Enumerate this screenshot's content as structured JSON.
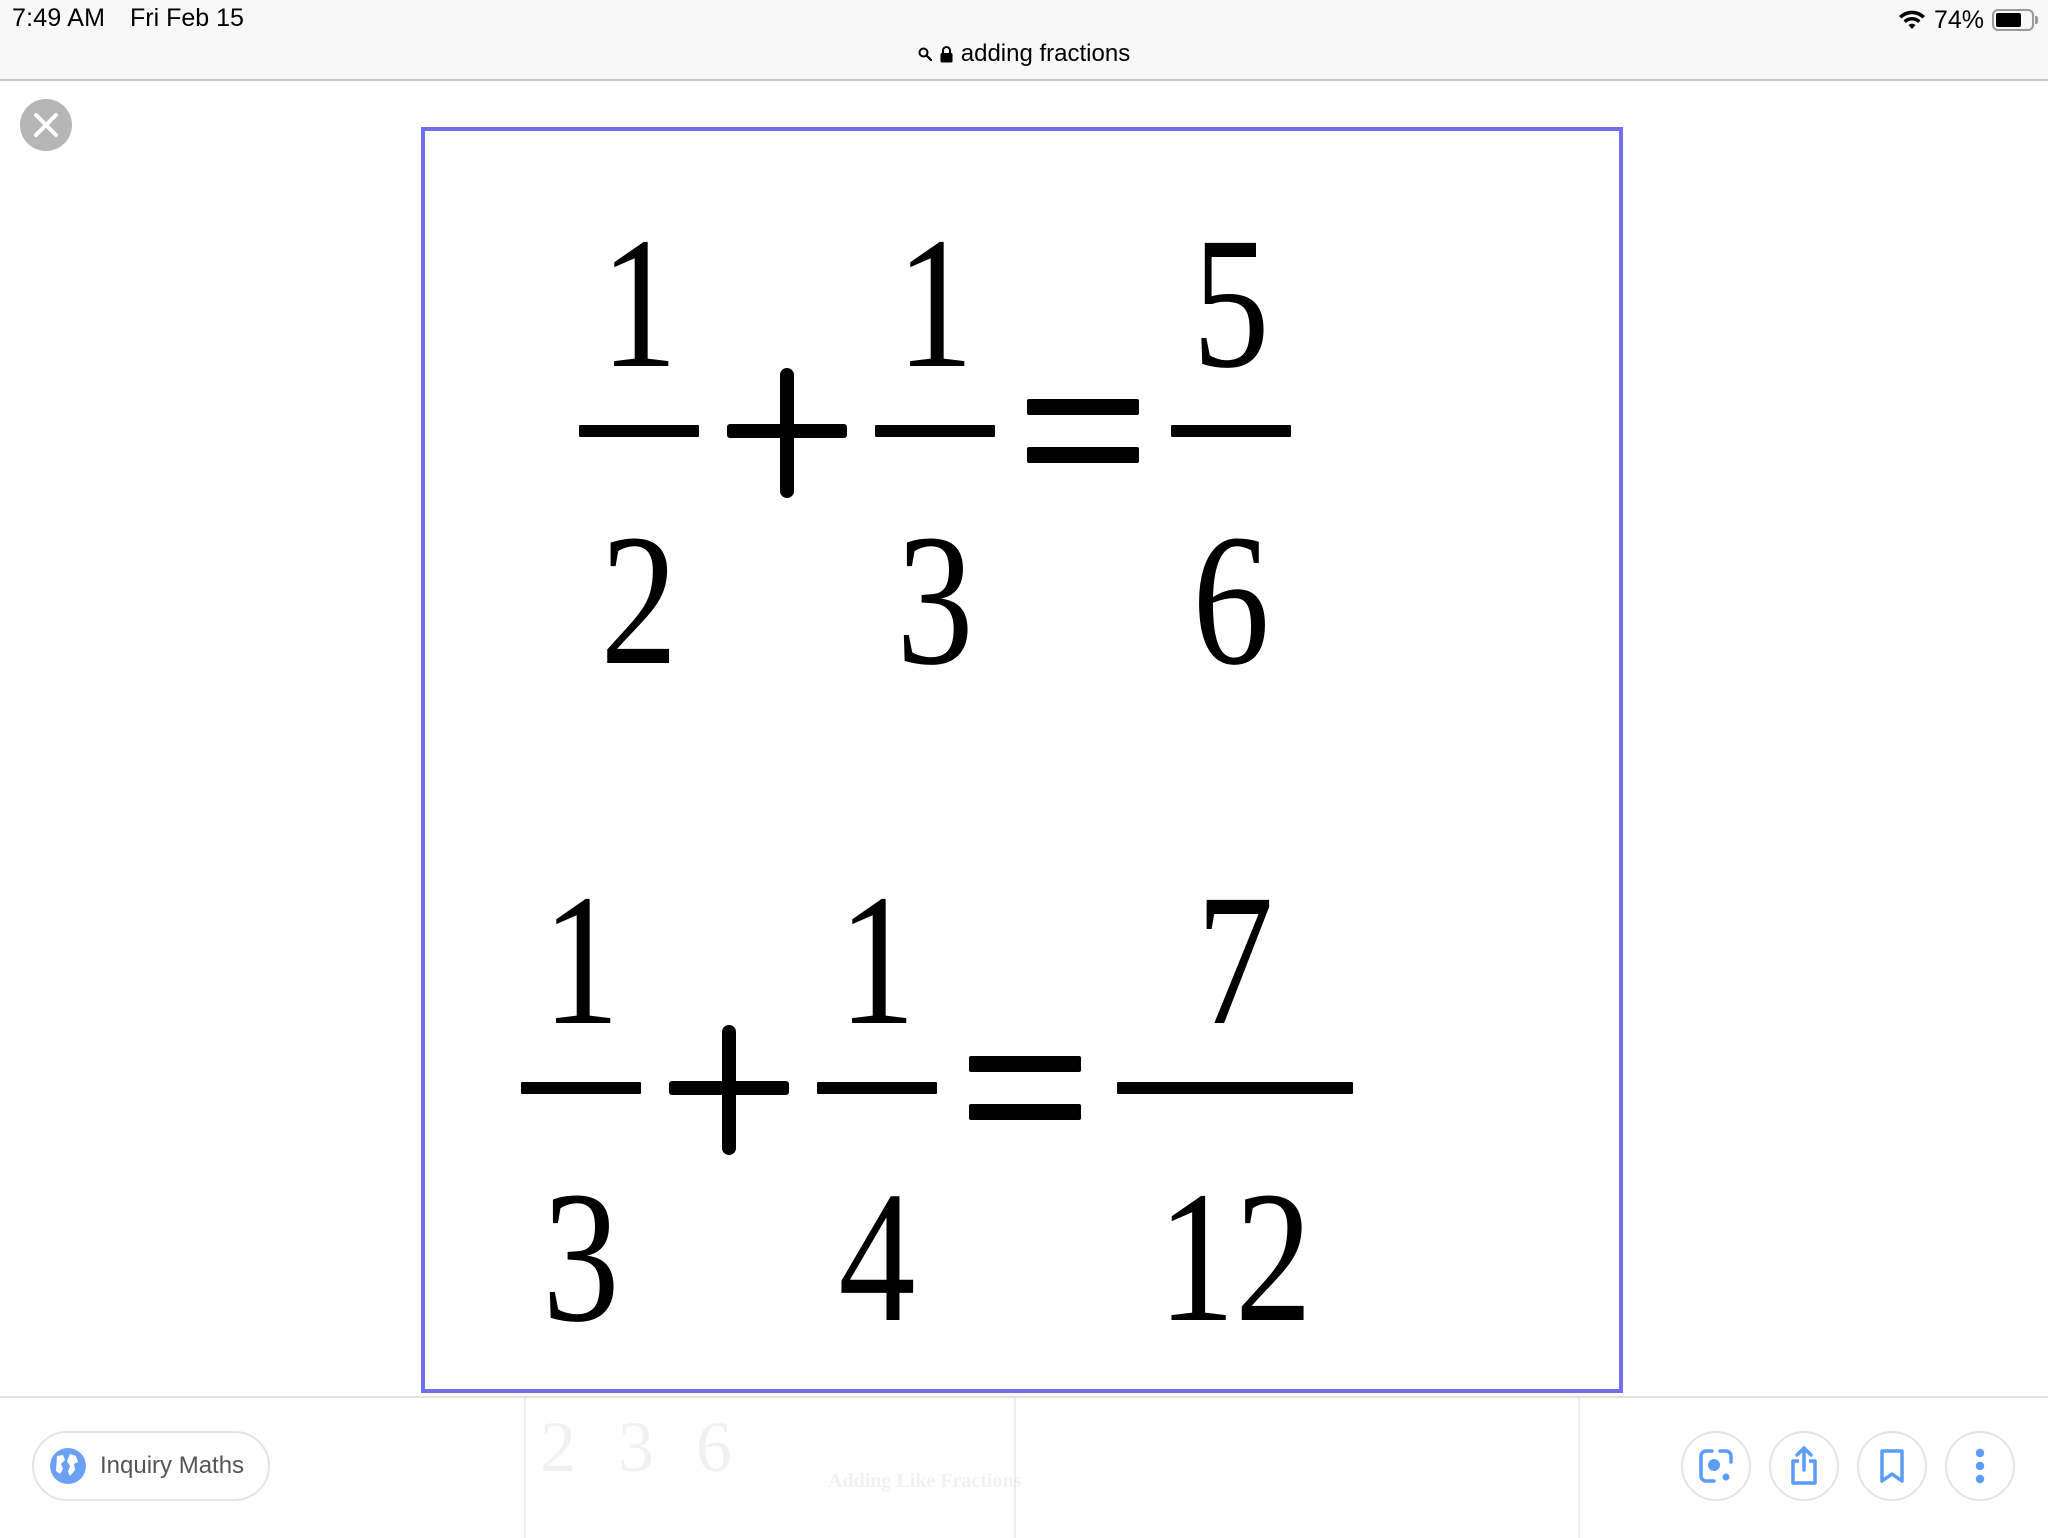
{
  "status_bar": {
    "time": "7:49 AM",
    "date": "Fri Feb 15",
    "battery_percent_label": "74%",
    "battery_level": 0.74,
    "wifi": "wifi-icon"
  },
  "url_bar": {
    "search_icon": "search-icon",
    "lock_icon": "lock-icon",
    "title": "adding fractions"
  },
  "viewer": {
    "close_label": "Close",
    "frame_color": "#7070ef",
    "equations": [
      {
        "left": {
          "numerator": "1",
          "denominator": "2"
        },
        "operator": "+",
        "right": {
          "numerator": "1",
          "denominator": "3"
        },
        "equals": "=",
        "result": {
          "numerator": "5",
          "denominator": "6"
        }
      },
      {
        "left": {
          "numerator": "1",
          "denominator": "3"
        },
        "operator": "+",
        "right": {
          "numerator": "1",
          "denominator": "4"
        },
        "equals": "=",
        "result": {
          "numerator": "7",
          "denominator": "12"
        }
      }
    ]
  },
  "background_results": {
    "ghost_digits": [
      "2",
      "3",
      "6"
    ],
    "ghost_title": "Adding Like Fractions"
  },
  "bottom_bar": {
    "source_label": "Inquiry Maths",
    "source_icon": "globe-icon",
    "accent_color": "#5b9cf6",
    "actions": [
      {
        "name": "lens-button",
        "icon": "lens-icon",
        "label": "Search with Lens"
      },
      {
        "name": "share-button",
        "icon": "share-icon",
        "label": "Share"
      },
      {
        "name": "bookmark-button",
        "icon": "bookmark-icon",
        "label": "Save"
      },
      {
        "name": "more-button",
        "icon": "more-vertical-icon",
        "label": "More"
      }
    ]
  }
}
